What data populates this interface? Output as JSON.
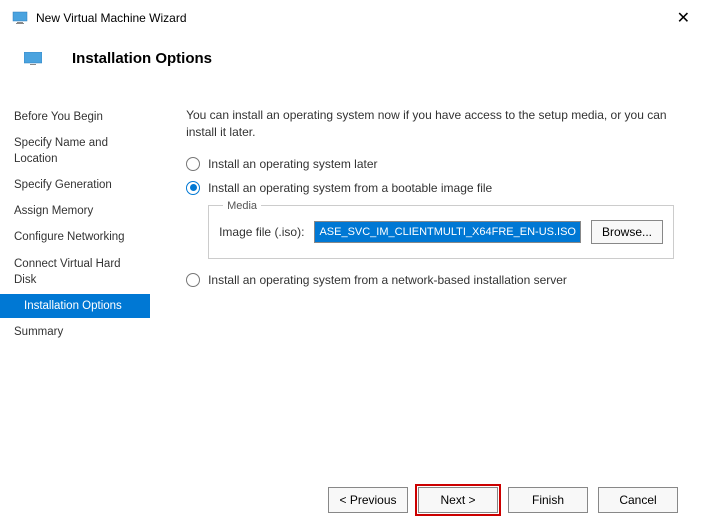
{
  "titlebar": {
    "title": "New Virtual Machine Wizard"
  },
  "header": {
    "title": "Installation Options"
  },
  "sidebar": {
    "items": [
      {
        "label": "Before You Begin"
      },
      {
        "label": "Specify Name and Location"
      },
      {
        "label": "Specify Generation"
      },
      {
        "label": "Assign Memory"
      },
      {
        "label": "Configure Networking"
      },
      {
        "label": "Connect Virtual Hard Disk"
      },
      {
        "label": "Installation Options"
      },
      {
        "label": "Summary"
      }
    ]
  },
  "content": {
    "intro": "You can install an operating system now if you have access to the setup media, or you can install it later.",
    "option_later": "Install an operating system later",
    "option_image": "Install an operating system from a bootable image file",
    "option_network": "Install an operating system from a network-based installation server",
    "media_legend": "Media",
    "image_file_label": "Image file (.iso):",
    "image_file_value": "ASE_SVC_IM_CLIENTMULTI_X64FRE_EN-US.ISO",
    "browse_label": "Browse..."
  },
  "footer": {
    "previous": "< Previous",
    "next": "Next >",
    "finish": "Finish",
    "cancel": "Cancel"
  }
}
